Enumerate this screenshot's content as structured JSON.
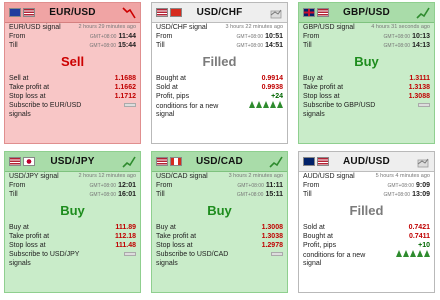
{
  "cards": {
    "eurusd": {
      "pair": "EUR/USD",
      "state": "sell",
      "signal_label": "EUR/USD signal",
      "age": "2 hours 29 minutes ago",
      "from_label": "From",
      "from_gmt": "GMT+08:00",
      "from_time": "11:44",
      "till_label": "Till",
      "till_gmt": "GMT+08:00",
      "till_time": "15:44",
      "action": "Sell",
      "rows": [
        {
          "label": "Sell at",
          "value": "1.1688"
        },
        {
          "label": "Take profit  at",
          "value": "1.1662"
        },
        {
          "label": "Stop loss at",
          "value": "1.1712"
        }
      ],
      "subscribe_line1": "Subscribe to EUR/USD",
      "subscribe_line2": "signals",
      "flags": [
        "eu",
        "us"
      ],
      "trend_icon": "trend-down-icon",
      "trend_color": "#cc0000"
    },
    "usdchf": {
      "pair": "USD/CHF",
      "state": "filled",
      "signal_label": "USD/CHF signal",
      "age": "3 hours 22 minutes ago",
      "from_label": "From",
      "from_gmt": "GMT+08:00",
      "from_time": "10:51",
      "till_label": "Till",
      "till_gmt": "GMT+08:00",
      "till_time": "14:51",
      "action": "Filled",
      "rows": [
        {
          "label": "Bought at",
          "value": "0.9914"
        },
        {
          "label": "Sold at",
          "value": "0.9938"
        },
        {
          "label": "Profit, pips",
          "value": "+24"
        }
      ],
      "conditions_line1": "conditions for a new",
      "conditions_line2": "signal",
      "tree_count": 5,
      "flags": [
        "us",
        "ch"
      ],
      "trend_icon": "chart-icon"
    },
    "gbpusd": {
      "pair": "GBP/USD",
      "state": "buy",
      "signal_label": "GBP/USD signal",
      "age": "4 hours 31 seconds ago",
      "from_label": "From",
      "from_gmt": "GMT+08:00",
      "from_time": "10:13",
      "till_label": "Till",
      "till_gmt": "GMT+08:00",
      "till_time": "14:13",
      "action": "Buy",
      "rows": [
        {
          "label": "Buy at",
          "value": "1.3111"
        },
        {
          "label": "Take profit  at",
          "value": "1.3138"
        },
        {
          "label": "Stop loss at",
          "value": "1.3088"
        }
      ],
      "subscribe_line1": "Subscribe to GBP/USD",
      "subscribe_line2": "signals",
      "flags": [
        "gb",
        "us"
      ],
      "trend_icon": "trend-up-icon",
      "trend_color": "#2e8b2e"
    },
    "usdjpy": {
      "pair": "USD/JPY",
      "state": "buy",
      "signal_label": "USD/JPY signal",
      "age": "2 hours 12 minutes ago",
      "from_label": "From",
      "from_gmt": "GMT+08:00",
      "from_time": "12:01",
      "till_label": "Till",
      "till_gmt": "GMT+08:00",
      "till_time": "16:01",
      "action": "Buy",
      "rows": [
        {
          "label": "Buy at",
          "value": "111.89"
        },
        {
          "label": "Take profit  at",
          "value": "112.18"
        },
        {
          "label": "Stop loss at",
          "value": "111.48"
        }
      ],
      "subscribe_line1": "Subscribe to USD/JPY",
      "subscribe_line2": "signals",
      "flags": [
        "us",
        "jp"
      ],
      "trend_icon": "trend-up-icon",
      "trend_color": "#2e8b2e"
    },
    "usdcad": {
      "pair": "USD/CAD",
      "state": "buy",
      "signal_label": "USD/CAD signal",
      "age": "3 hours 2 minutes ago",
      "from_label": "From",
      "from_gmt": "GMT+08:00",
      "from_time": "11:11",
      "till_label": "Till",
      "till_gmt": "GMT+08:00",
      "till_time": "15:11",
      "action": "Buy",
      "rows": [
        {
          "label": "Buy at",
          "value": "1.3008"
        },
        {
          "label": "Take profit  at",
          "value": "1.3038"
        },
        {
          "label": "Stop loss at",
          "value": "1.2978"
        }
      ],
      "subscribe_line1": "Subscribe to USD/CAD",
      "subscribe_line2": "signals",
      "flags": [
        "us",
        "ca"
      ],
      "trend_icon": "trend-up-icon",
      "trend_color": "#2e8b2e"
    },
    "audusd": {
      "pair": "AUD/USD",
      "state": "filled",
      "signal_label": "AUD/USD signal",
      "age": "5 hours 4 minutes ago",
      "from_label": "From",
      "from_gmt": "GMT+08:00",
      "from_time": "9:09",
      "till_label": "Till",
      "till_gmt": "GMT+08:00",
      "till_time": "13:09",
      "action": "Filled",
      "rows": [
        {
          "label": "Sold at",
          "value": "0.7421"
        },
        {
          "label": "Bought at",
          "value": "0.7411"
        },
        {
          "label": "Profit, pips",
          "value": "+10"
        }
      ],
      "conditions_line1": "conditions for a new",
      "conditions_line2": "signal",
      "tree_count": 5,
      "flags": [
        "au",
        "us"
      ],
      "trend_icon": "chart-icon"
    }
  }
}
